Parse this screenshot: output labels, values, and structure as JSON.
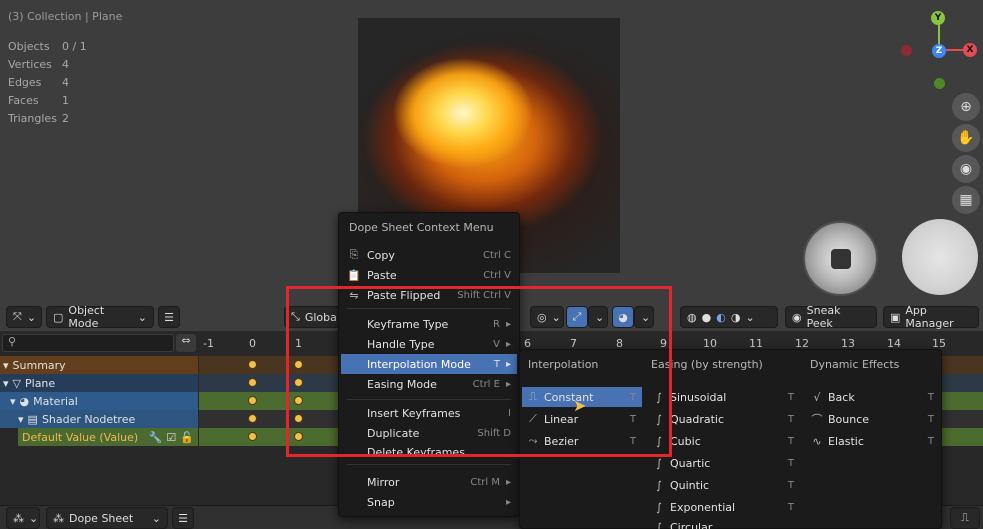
{
  "viewport": {
    "header": "(3) Collection | Plane",
    "stats": [
      {
        "label": "Objects",
        "value": "0 / 1"
      },
      {
        "label": "Vertices",
        "value": "4"
      },
      {
        "label": "Edges",
        "value": "4"
      },
      {
        "label": "Faces",
        "value": "1"
      },
      {
        "label": "Triangles",
        "value": "2"
      }
    ],
    "gizmo": {
      "y": "Y",
      "z": "Z",
      "x": "X"
    },
    "colors": {
      "x": "#e44c55",
      "y": "#8ac43e",
      "z": "#3f87f0"
    }
  },
  "header_bar": {
    "mode_label": "Object Mode",
    "transform_label": "Globa",
    "sneak_peek_label": "Sneak Peek",
    "app_manager_label": "App Manager"
  },
  "dopesheet": {
    "search_placeholder": "",
    "frames": [
      "-1",
      "0",
      "1",
      "6",
      "7",
      "8",
      "9",
      "10",
      "11",
      "12",
      "13",
      "14",
      "15"
    ],
    "channels": [
      {
        "label": "Summary"
      },
      {
        "label": "Plane"
      },
      {
        "label": "Material"
      },
      {
        "label": "Shader Nodetree"
      },
      {
        "label": "Default Value (Value)"
      }
    ]
  },
  "bottom_bar": {
    "editor_label": "Dope Sheet"
  },
  "context_menu": {
    "title": "Dope Sheet Context Menu",
    "items": [
      {
        "label": "Copy",
        "shortcut": "Ctrl C"
      },
      {
        "label": "Paste",
        "shortcut": "Ctrl V"
      },
      {
        "label": "Paste Flipped",
        "shortcut": "Shift Ctrl V"
      },
      {
        "label": "Keyframe Type",
        "shortcut": "R"
      },
      {
        "label": "Handle Type",
        "shortcut": "V"
      },
      {
        "label": "Interpolation Mode",
        "shortcut": "T"
      },
      {
        "label": "Easing Mode",
        "shortcut": "Ctrl E"
      },
      {
        "label": "Insert Keyframes",
        "shortcut": "I"
      },
      {
        "label": "Duplicate",
        "shortcut": "Shift D"
      },
      {
        "label": "Delete Keyframes",
        "shortcut": ""
      },
      {
        "label": "Mirror",
        "shortcut": "Ctrl M"
      },
      {
        "label": "Snap",
        "shortcut": ""
      }
    ]
  },
  "submenu": {
    "headers": {
      "interpolation": "Interpolation",
      "easing": "Easing (by strength)",
      "dynamic": "Dynamic Effects"
    },
    "interpolation": [
      {
        "label": "Constant",
        "shortcut": "T"
      },
      {
        "label": "Linear",
        "shortcut": "T"
      },
      {
        "label": "Bezier",
        "shortcut": "T"
      }
    ],
    "easing": [
      {
        "label": "Sinusoidal",
        "shortcut": "T"
      },
      {
        "label": "Quadratic",
        "shortcut": "T"
      },
      {
        "label": "Cubic",
        "shortcut": "T"
      },
      {
        "label": "Quartic",
        "shortcut": "T"
      },
      {
        "label": "Quintic",
        "shortcut": "T"
      },
      {
        "label": "Exponential",
        "shortcut": "T"
      },
      {
        "label": "Circular",
        "shortcut": ""
      }
    ],
    "dynamic": [
      {
        "label": "Back",
        "shortcut": "T"
      },
      {
        "label": "Bounce",
        "shortcut": "T"
      },
      {
        "label": "Elastic",
        "shortcut": "T"
      }
    ]
  },
  "highlight_color": "#4772b3",
  "annotation_color": "#e3262c"
}
